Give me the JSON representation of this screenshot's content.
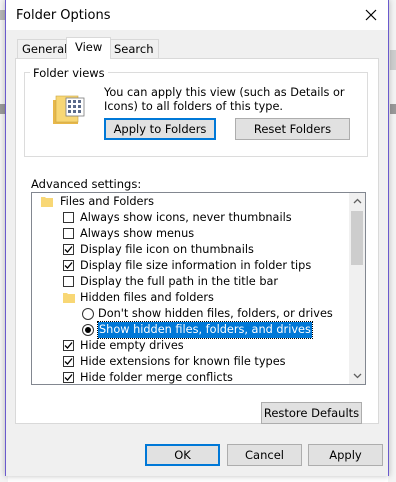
{
  "window": {
    "title": "Folder Options"
  },
  "tabs": [
    {
      "label": "General"
    },
    {
      "label": "View"
    },
    {
      "label": "Search"
    }
  ],
  "folder_views": {
    "legend": "Folder views",
    "description": "You can apply this view (such as Details or Icons) to all folders of this type.",
    "apply_button": "Apply to Folders",
    "reset_button": "Reset Folders"
  },
  "advanced": {
    "label": "Advanced settings:",
    "items": [
      {
        "type": "folder",
        "label": "Files and Folders",
        "level": 0
      },
      {
        "type": "checkbox",
        "label": "Always show icons, never thumbnails",
        "checked": false
      },
      {
        "type": "checkbox",
        "label": "Always show menus",
        "checked": false
      },
      {
        "type": "checkbox",
        "label": "Display file icon on thumbnails",
        "checked": true
      },
      {
        "type": "checkbox",
        "label": "Display file size information in folder tips",
        "checked": true
      },
      {
        "type": "checkbox",
        "label": "Display the full path in the title bar",
        "checked": false
      },
      {
        "type": "folder",
        "label": "Hidden files and folders",
        "level": 1
      },
      {
        "type": "radio",
        "label": "Don't show hidden files, folders, or drives",
        "checked": false
      },
      {
        "type": "radio",
        "label": "Show hidden files, folders, and drives",
        "checked": true,
        "selected": true
      },
      {
        "type": "checkbox",
        "label": "Hide empty drives",
        "checked": true
      },
      {
        "type": "checkbox",
        "label": "Hide extensions for known file types",
        "checked": true
      },
      {
        "type": "checkbox",
        "label": "Hide folder merge conflicts",
        "checked": true
      }
    ]
  },
  "restore_defaults_button": "Restore Defaults",
  "footer": {
    "ok": "OK",
    "cancel": "Cancel",
    "apply": "Apply"
  },
  "colors": {
    "accent": "#0078d7",
    "window_border": "#6a5acd",
    "dialog_bg": "#f0f0f0",
    "folder_yellow": "#f8d775"
  },
  "icons": {
    "close": "close-icon",
    "folder": "folder-icon",
    "folder_views": "folder-views-icon",
    "scroll_up": "chevron-up-icon",
    "scroll_down": "chevron-down-icon"
  }
}
